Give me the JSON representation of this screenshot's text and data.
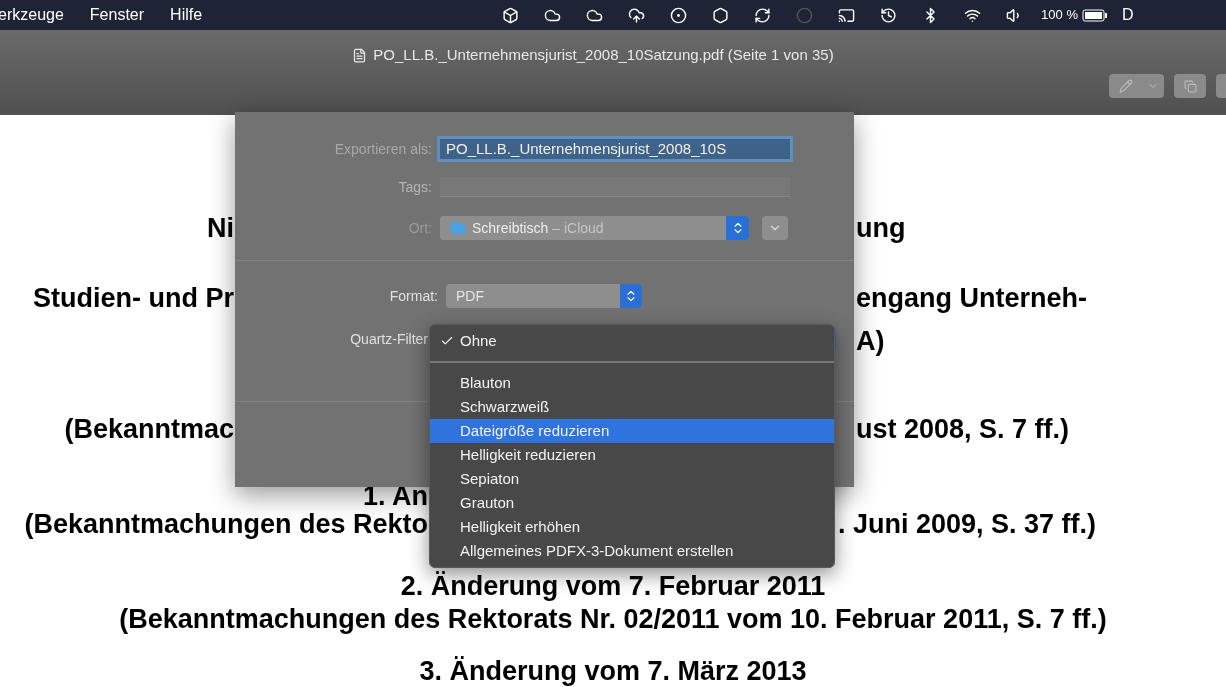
{
  "menu_bar": {
    "items": [
      "erkzeuge",
      "Fenster",
      "Hilfe"
    ],
    "battery": "100 %",
    "edge_text": "D"
  },
  "window": {
    "title": "PO_LL.B._Unternehmensjurist_2008_10Satzung.pdf (Seite 1 von 35)"
  },
  "document": {
    "lines": [
      {
        "kind": "split_dialog",
        "left": "Ni",
        "right": "ung"
      },
      {
        "kind": "split_dialog",
        "left": "Studien- und Pr",
        "right": "engang Unterneh-"
      },
      {
        "kind": "split_dialog",
        "right": "A)"
      },
      {
        "kind": "split_dialog",
        "left": "(Bekanntmac",
        "right": "ust 2008, S. 7 ff.)"
      },
      {
        "kind": "split_menu",
        "left": "1. An"
      },
      {
        "kind": "split_menu",
        "left": "(Bekanntmachungen des Rekto",
        "right": ". Juni 2009, S. 37 ff.)"
      },
      {
        "kind": "full",
        "text": "2. Änderung vom 7. Februar 2011"
      },
      {
        "kind": "full",
        "text": "(Bekanntmachungen des Rektorats Nr. 02/2011 vom 10. Februar 2011, S. 7 ff.)"
      },
      {
        "kind": "full",
        "text": "3. Änderung vom 7. März 2013"
      }
    ]
  },
  "dialog": {
    "export_label": "Exportieren als:",
    "export_value": "PO_LL.B._Unternehmensjurist_2008_10S",
    "tags_label": "Tags:",
    "location_label": "Ort:",
    "location_value": "Schreibtisch",
    "location_suffix": "– iCloud",
    "format_label": "Format:",
    "format_value": "PDF",
    "quartz_label": "Quartz-Filter"
  },
  "filter_menu": {
    "groups": [
      [
        {
          "label": "Ohne",
          "checked": true,
          "highlighted": false
        }
      ],
      [
        {
          "label": "Blauton",
          "checked": false,
          "highlighted": false
        },
        {
          "label": "Schwarzweiß",
          "checked": false,
          "highlighted": false
        },
        {
          "label": "Dateigröße reduzieren",
          "checked": false,
          "highlighted": true
        },
        {
          "label": "Helligkeit reduzieren",
          "checked": false,
          "highlighted": false
        },
        {
          "label": "Sepiaton",
          "checked": false,
          "highlighted": false
        },
        {
          "label": "Grauton",
          "checked": false,
          "highlighted": false
        },
        {
          "label": "Helligkeit erhöhen",
          "checked": false,
          "highlighted": false
        },
        {
          "label": "Allgemeines PDFX-3-Dokument erstellen",
          "checked": false,
          "highlighted": false
        }
      ]
    ]
  }
}
